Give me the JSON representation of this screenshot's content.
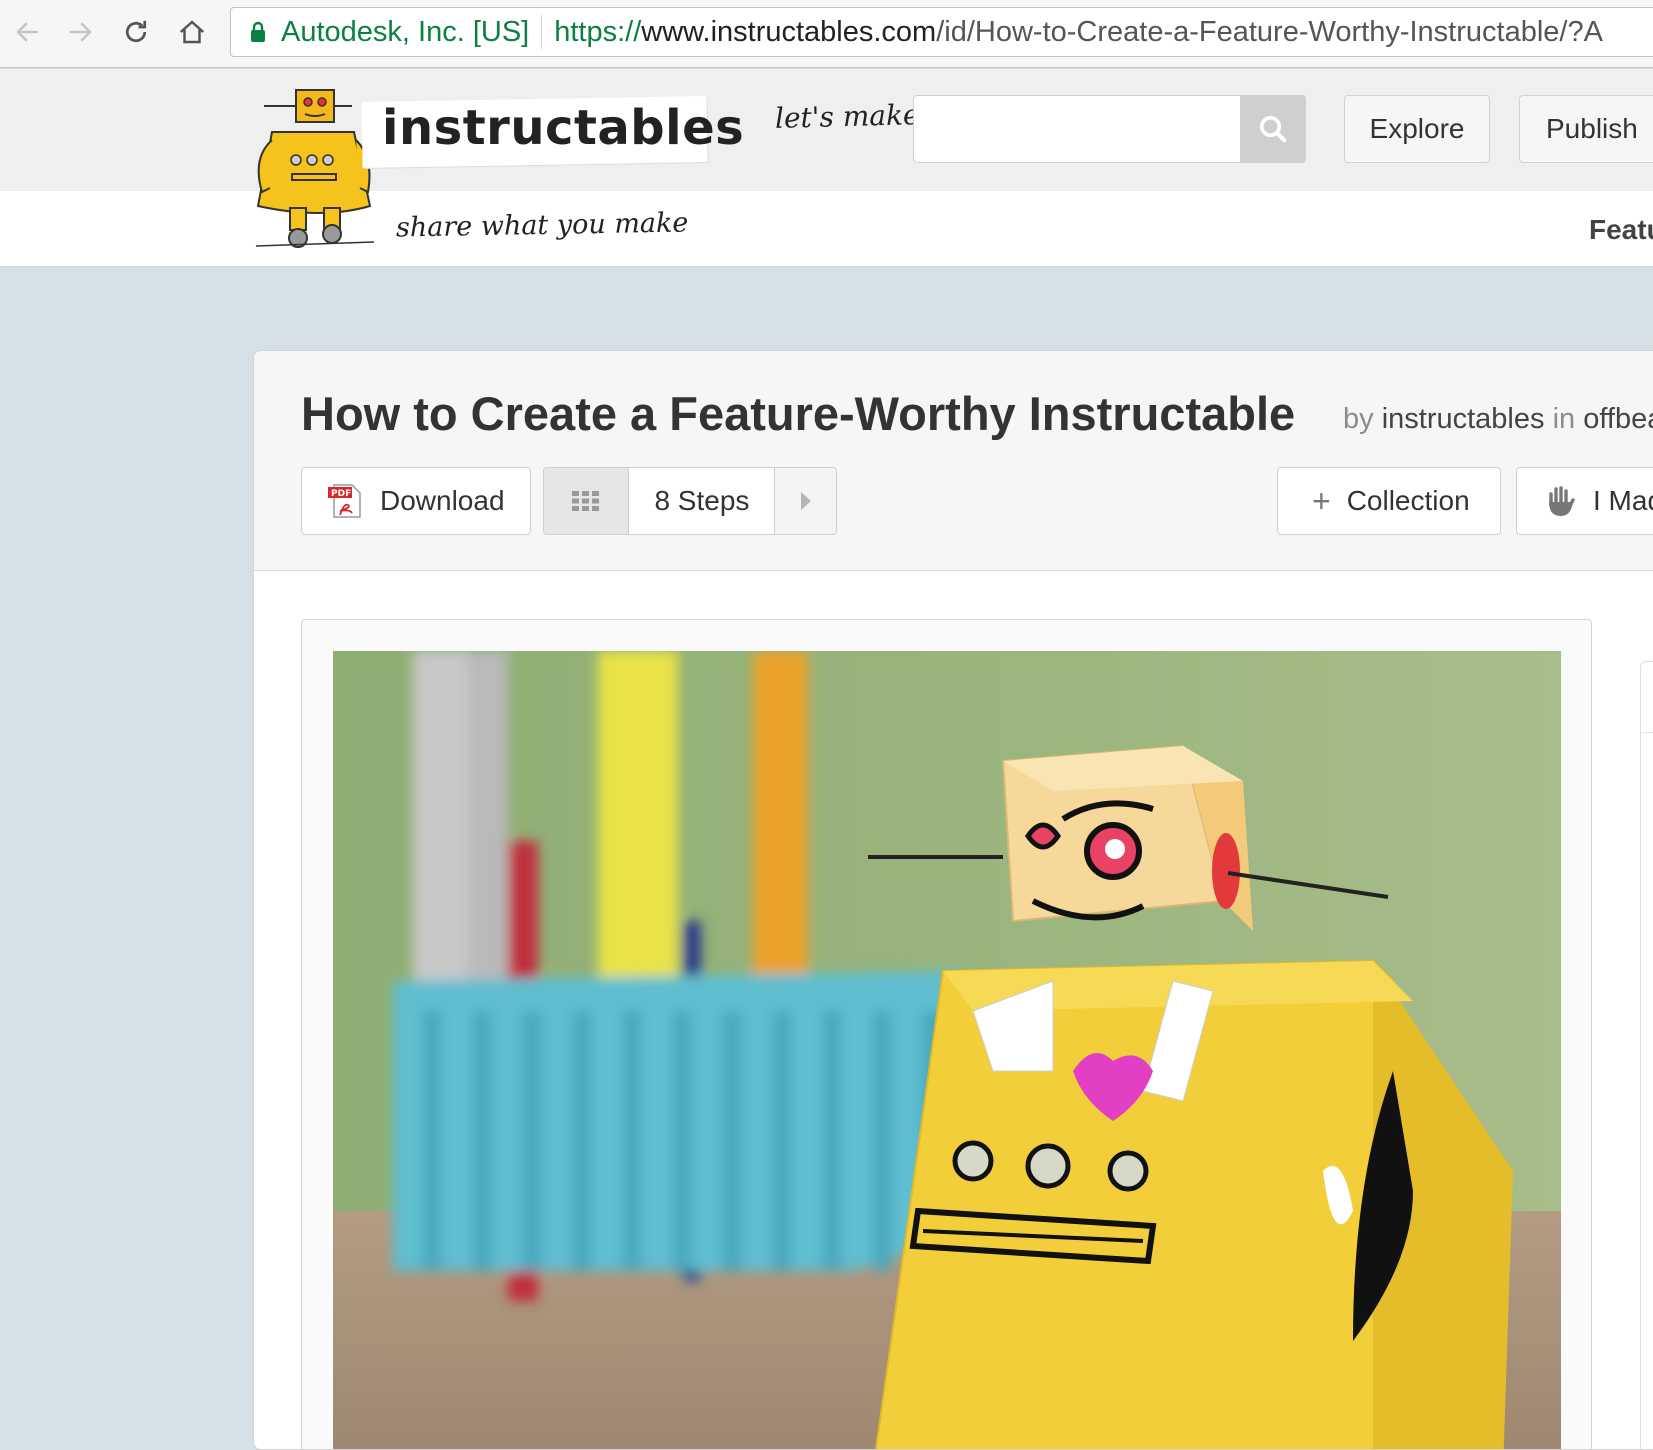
{
  "browser": {
    "site_identity": "Autodesk, Inc. [US]",
    "url_scheme": "https://",
    "url_host": "www.instructables.com",
    "url_path": "/id/How-to-Create-a-Feature-Worthy-Instructable/?A"
  },
  "header": {
    "logo_text": "instructables",
    "tagline": "share what you make",
    "search_prompt": "let's make",
    "search_placeholder": "",
    "nav": {
      "explore": "Explore",
      "publish": "Publish",
      "featured": "Featu"
    }
  },
  "article": {
    "title": "How to Create a Feature-Worthy Instructable",
    "by": "by",
    "author": "instructables",
    "in": "in",
    "category": "offbea",
    "actions": {
      "download": "Download",
      "steps": "8 Steps",
      "collection": "Collection",
      "i_made_it": "I Mad"
    }
  },
  "colors": {
    "site_identity_green": "#0b8043",
    "page_background": "#d5e0e6",
    "header_background": "#efefef"
  },
  "icons": [
    "back-arrow-icon",
    "forward-arrow-icon",
    "reload-icon",
    "home-icon",
    "lock-icon",
    "search-icon",
    "pdf-icon",
    "grid-icon",
    "chevron-right-icon",
    "plus-icon",
    "hand-icon"
  ]
}
